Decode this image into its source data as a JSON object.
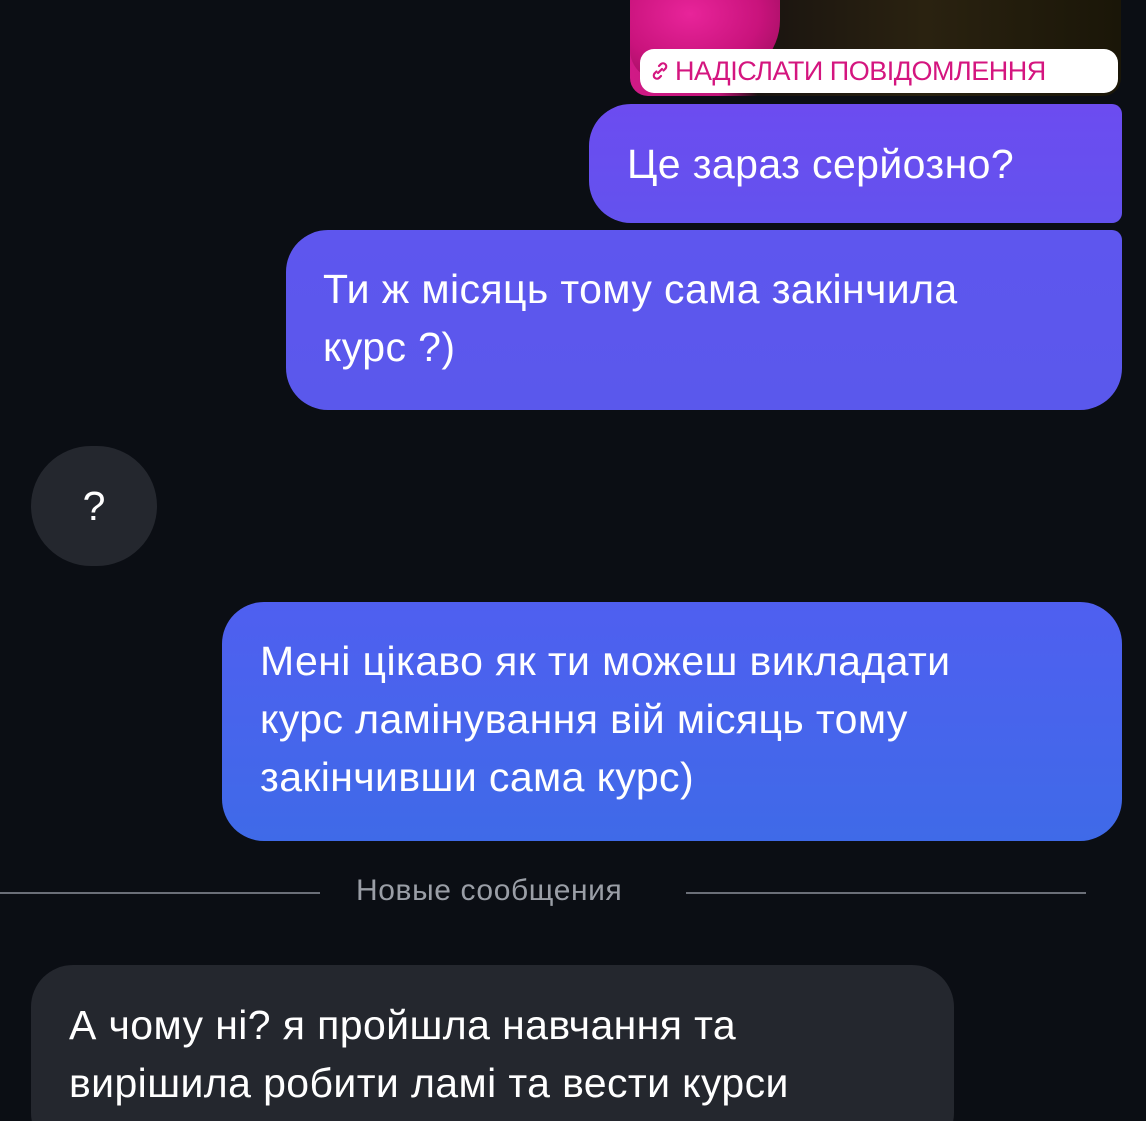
{
  "story_reply": {
    "label": "НАДІСЛАТИ ПОВІДОМЛЕННЯ",
    "icon": "link-icon"
  },
  "messages": [
    {
      "direction": "outgoing",
      "lines": [
        "Це зараз серйозно?"
      ]
    },
    {
      "direction": "outgoing",
      "lines": [
        "Ти ж місяць тому сама закінчила",
        "курс ?)"
      ]
    },
    {
      "direction": "incoming",
      "lines": [
        "?"
      ]
    },
    {
      "direction": "outgoing",
      "lines": [
        "Мені цікаво як ти можеш викладати",
        "курс ламінування вій місяць тому",
        "закінчивши сама курс)"
      ]
    },
    {
      "direction": "incoming",
      "lines": [
        "А чому ні? я пройшла навчання та",
        "вирішила робити ламі та вести курси"
      ]
    }
  ],
  "divider": {
    "label": "Новые сообщения"
  },
  "colors": {
    "background": "#0b0e14",
    "outgoing_top": "#6c4cf0",
    "outgoing_bottom": "#3f6ae8",
    "incoming": "#24272e",
    "story_pill_text": "#d4157f"
  }
}
